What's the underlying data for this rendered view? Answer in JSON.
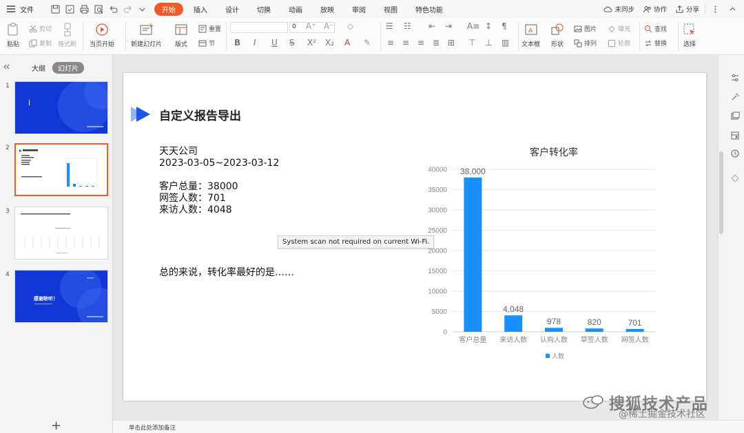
{
  "app": {
    "file_label": "文件",
    "tabs": [
      "开始",
      "插入",
      "设计",
      "切换",
      "动画",
      "放映",
      "审阅",
      "视图",
      "特色功能"
    ],
    "active_tab": "开始",
    "right_buttons": {
      "sync": "未同步",
      "collab": "协作",
      "share": "分享"
    },
    "accent_color": "#f25a29"
  },
  "ribbon": {
    "paste": "粘贴",
    "cut": "剪切",
    "copy": "复制",
    "format_painter": "格式刷",
    "play_from_current": "当页开始",
    "new_slide": "新建幻灯片",
    "layout": "版式",
    "reset": "重置",
    "section": "节",
    "font_size": "0",
    "textbox": "文本框",
    "shape": "形状",
    "picture": "图片",
    "arrange": "排列",
    "fill": "填充",
    "outline": "轮廓",
    "find": "查找",
    "replace": "替换",
    "select": "选择"
  },
  "left_pane": {
    "tab_outline": "大纲",
    "tab_slides": "幻灯片",
    "slide_numbers": [
      "1",
      "2",
      "3",
      "4"
    ],
    "selected_slide": 2,
    "thumb4_text": "感谢聆听！",
    "add_slide": "+"
  },
  "slide": {
    "title": "自定义报告导出",
    "company": "天天公司",
    "date_range": "2023-03-05~2023-03-12",
    "stat_total": "客户总量：38000",
    "stat_signed": "网签人数：701",
    "stat_visit": "来访人数：4048",
    "summary": "总的来说，转化率最好的是……",
    "tooltip": "System scan not required on current Wi-Fi."
  },
  "chart_data": {
    "type": "bar",
    "title": "客户转化率",
    "categories": [
      "客户总量",
      "来访人数",
      "认购人数",
      "草签人数",
      "网签人数"
    ],
    "series": [
      {
        "name": "人数",
        "values": [
          38000,
          4048,
          978,
          820,
          701
        ],
        "color": "#1890ff"
      }
    ],
    "data_labels": [
      "38,000",
      "4,048",
      "978",
      "820",
      "701"
    ],
    "yticks": [
      "0",
      "5000",
      "10000",
      "15000",
      "20000",
      "25000",
      "30000",
      "35000",
      "40000"
    ],
    "ylim": [
      0,
      40000
    ],
    "grid": true,
    "legend_position": "bottom"
  },
  "notes": {
    "placeholder": "单击此处添加备注"
  },
  "watermark": {
    "line1": "搜狐技术产品",
    "line2": "@稀土掘金技术社区"
  }
}
